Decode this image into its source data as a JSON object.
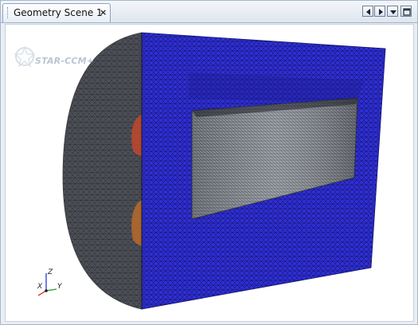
{
  "tab": {
    "title": "Geometry Scene 1",
    "close_glyph": "×"
  },
  "window_controls": [
    {
      "name": "scroll-left-icon"
    },
    {
      "name": "scroll-right-icon"
    },
    {
      "name": "tab-list-dropdown-icon"
    },
    {
      "name": "maximize-icon"
    }
  ],
  "scene": {
    "logo_text": "STAR-CCM+",
    "triad": {
      "z": "Z",
      "x": "X",
      "y": "Y"
    },
    "colors": {
      "background": "#ffffff",
      "outer_mesh_face": "#2f2fd8",
      "cylinder_mesh": "#4d4f57",
      "inner_cavity": "#8f949c",
      "highlight_upper": "#c2472b",
      "highlight_lower": "#b86a2a",
      "triad_x": "#d21d1d",
      "triad_y": "#1e9b1e",
      "triad_z": "#1d3cd2"
    }
  }
}
